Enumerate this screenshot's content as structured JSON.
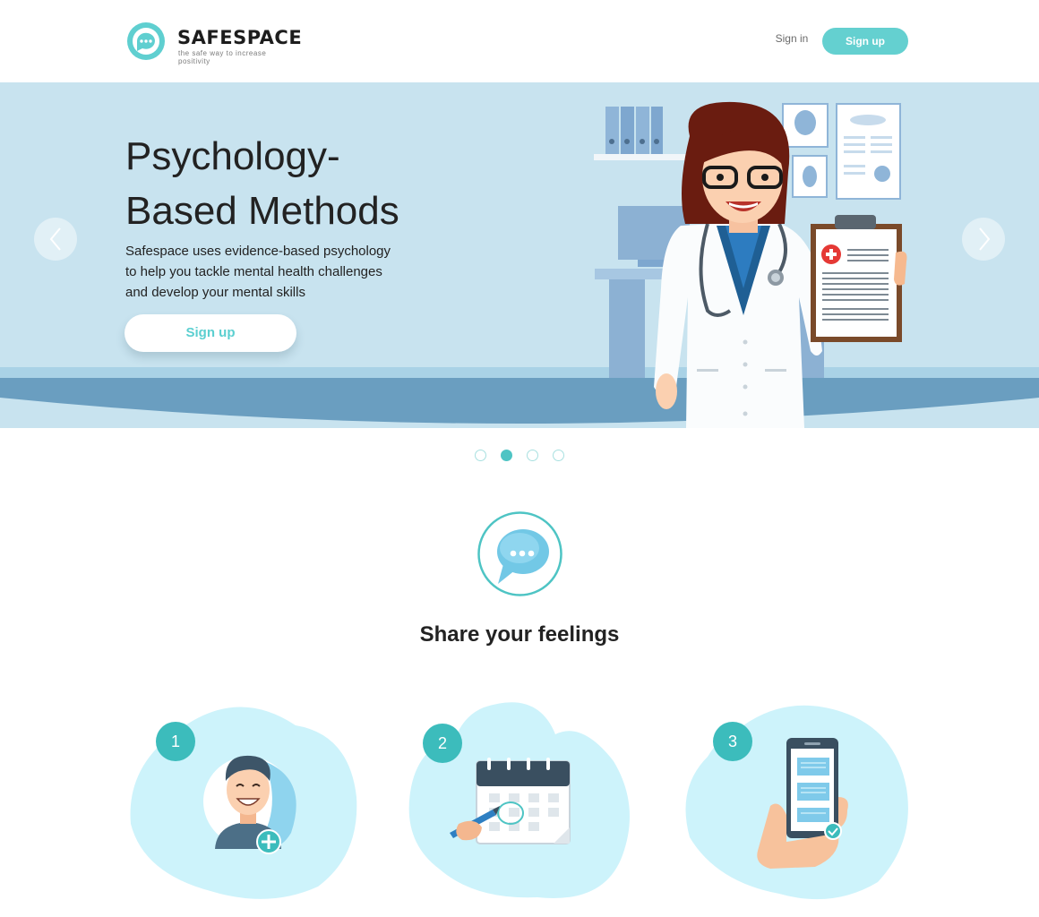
{
  "header": {
    "brand_name": "SAFESPACE",
    "brand_tagline": "the safe way to increase positivity",
    "signin_label": "Sign in",
    "signup_label": "Sign up"
  },
  "hero": {
    "title_line1": "Psychology-",
    "title_line2": "Based Methods",
    "description_line1": "Safespace uses evidence-based psychology",
    "description_line2": "to help you tackle mental health challenges",
    "description_line3": "and develop your mental skills",
    "cta_label": "Sign up",
    "prev_icon": "chevron-left-icon",
    "next_icon": "chevron-right-icon",
    "illustration": "doctor-with-clipboard-illustration"
  },
  "carousel": {
    "slide_count": 4,
    "active_index": 1
  },
  "share": {
    "icon": "chat-bubble-icon",
    "title": "Share your feelings"
  },
  "steps": [
    {
      "number": "1",
      "icon": "add-user-icon"
    },
    {
      "number": "2",
      "icon": "calendar-icon"
    },
    {
      "number": "3",
      "icon": "phone-chat-icon"
    }
  ],
  "colors": {
    "accent": "#64d0d0",
    "hero_bg": "#c8e3ef",
    "hero_floor": "#6a9ec0",
    "step_blob": "#cdf3fb",
    "step_number": "#3cbcbc"
  }
}
